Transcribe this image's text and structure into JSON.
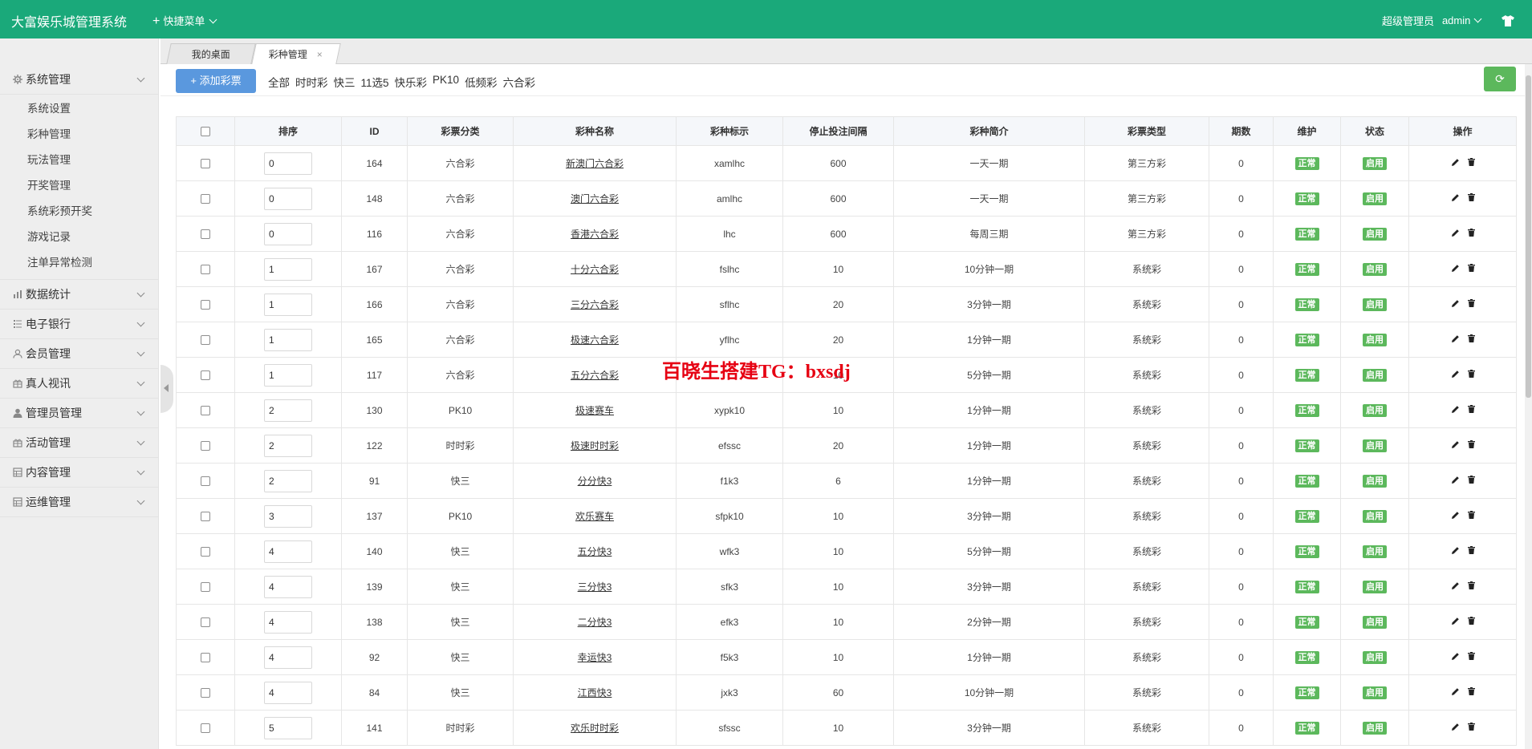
{
  "header": {
    "brand": "大富娱乐城管理系统",
    "quick_menu": "快捷菜单",
    "role": "超级管理员",
    "user": "admin"
  },
  "sidebar": {
    "groups": [
      {
        "label": "系统管理",
        "icon": "gear-icon",
        "expanded": true,
        "items": [
          "系统设置",
          "彩种管理",
          "玩法管理",
          "开奖管理",
          "系统彩预开奖",
          "游戏记录",
          "注单异常检测"
        ]
      },
      {
        "label": "数据统计",
        "icon": "bar-chart-icon"
      },
      {
        "label": "电子银行",
        "icon": "list-icon"
      },
      {
        "label": "会员管理",
        "icon": "user-icon"
      },
      {
        "label": "真人视讯",
        "icon": "gift-icon"
      },
      {
        "label": "管理员管理",
        "icon": "admin-icon"
      },
      {
        "label": "活动管理",
        "icon": "gift-icon"
      },
      {
        "label": "内容管理",
        "icon": "table-icon"
      },
      {
        "label": "运维管理",
        "icon": "table-icon"
      }
    ]
  },
  "tabs": [
    {
      "label": "我的桌面"
    },
    {
      "label": "彩种管理",
      "close": "×"
    }
  ],
  "toolbar": {
    "add_label": "添加彩票",
    "filters": [
      "全部",
      "时时彩",
      "快三",
      "11选5",
      "快乐彩",
      "PK10",
      "低频彩",
      "六合彩"
    ]
  },
  "table": {
    "columns": [
      "排序",
      "ID",
      "彩票分类",
      "彩种名称",
      "彩种标示",
      "停止投注间隔",
      "彩种简介",
      "彩票类型",
      "期数",
      "维护",
      "状态",
      "操作"
    ],
    "rows": [
      {
        "sort": "0",
        "id": "164",
        "cat": "六合彩",
        "name": "新澳门六合彩",
        "code": "xamlhc",
        "stop": "600",
        "desc": "一天一期",
        "type": "第三方彩",
        "periods": "0"
      },
      {
        "sort": "0",
        "id": "148",
        "cat": "六合彩",
        "name": "澳门六合彩",
        "code": "amlhc",
        "stop": "600",
        "desc": "一天一期",
        "type": "第三方彩",
        "periods": "0"
      },
      {
        "sort": "0",
        "id": "116",
        "cat": "六合彩",
        "name": "香港六合彩",
        "code": "lhc",
        "stop": "600",
        "desc": "每周三期",
        "type": "第三方彩",
        "periods": "0"
      },
      {
        "sort": "1",
        "id": "167",
        "cat": "六合彩",
        "name": "十分六合彩",
        "code": "fslhc",
        "stop": "10",
        "desc": "10分钟一期",
        "type": "系统彩",
        "periods": "0"
      },
      {
        "sort": "1",
        "id": "166",
        "cat": "六合彩",
        "name": "三分六合彩",
        "code": "sflhc",
        "stop": "20",
        "desc": "3分钟一期",
        "type": "系统彩",
        "periods": "0"
      },
      {
        "sort": "1",
        "id": "165",
        "cat": "六合彩",
        "name": "极速六合彩",
        "code": "yflhc",
        "stop": "20",
        "desc": "1分钟一期",
        "type": "系统彩",
        "periods": "0"
      },
      {
        "sort": "1",
        "id": "117",
        "cat": "六合彩",
        "name": "五分六合彩",
        "code": "",
        "stop": "10",
        "desc": "5分钟一期",
        "type": "系统彩",
        "periods": "0"
      },
      {
        "sort": "2",
        "id": "130",
        "cat": "PK10",
        "name": "极速赛车",
        "code": "xypk10",
        "stop": "10",
        "desc": "1分钟一期",
        "type": "系统彩",
        "periods": "0"
      },
      {
        "sort": "2",
        "id": "122",
        "cat": "时时彩",
        "name": "极速时时彩",
        "code": "efssc",
        "stop": "20",
        "desc": "1分钟一期",
        "type": "系统彩",
        "periods": "0"
      },
      {
        "sort": "2",
        "id": "91",
        "cat": "快三",
        "name": "分分快3",
        "code": "f1k3",
        "stop": "6",
        "desc": "1分钟一期",
        "type": "系统彩",
        "periods": "0"
      },
      {
        "sort": "3",
        "id": "137",
        "cat": "PK10",
        "name": "欢乐赛车",
        "code": "sfpk10",
        "stop": "10",
        "desc": "3分钟一期",
        "type": "系统彩",
        "periods": "0"
      },
      {
        "sort": "4",
        "id": "140",
        "cat": "快三",
        "name": "五分快3",
        "code": "wfk3",
        "stop": "10",
        "desc": "5分钟一期",
        "type": "系统彩",
        "periods": "0"
      },
      {
        "sort": "4",
        "id": "139",
        "cat": "快三",
        "name": "三分快3",
        "code": "sfk3",
        "stop": "10",
        "desc": "3分钟一期",
        "type": "系统彩",
        "periods": "0"
      },
      {
        "sort": "4",
        "id": "138",
        "cat": "快三",
        "name": "二分快3",
        "code": "efk3",
        "stop": "10",
        "desc": "2分钟一期",
        "type": "系统彩",
        "periods": "0"
      },
      {
        "sort": "4",
        "id": "92",
        "cat": "快三",
        "name": "幸运快3",
        "code": "f5k3",
        "stop": "10",
        "desc": "1分钟一期",
        "type": "系统彩",
        "periods": "0"
      },
      {
        "sort": "4",
        "id": "84",
        "cat": "快三",
        "name": "江西快3",
        "code": "jxk3",
        "stop": "60",
        "desc": "10分钟一期",
        "type": "系统彩",
        "periods": "0"
      },
      {
        "sort": "5",
        "id": "141",
        "cat": "时时彩",
        "name": "欢乐时时彩",
        "code": "sfssc",
        "stop": "10",
        "desc": "3分钟一期",
        "type": "系统彩",
        "periods": "0"
      }
    ],
    "maint_label": "正常",
    "status_label": "启用"
  },
  "watermark": "百晓生搭建TG：bxsdj",
  "colors": {
    "topbar": "#1aa97a",
    "primary_btn": "#5a98de",
    "success": "#5cb85c"
  }
}
